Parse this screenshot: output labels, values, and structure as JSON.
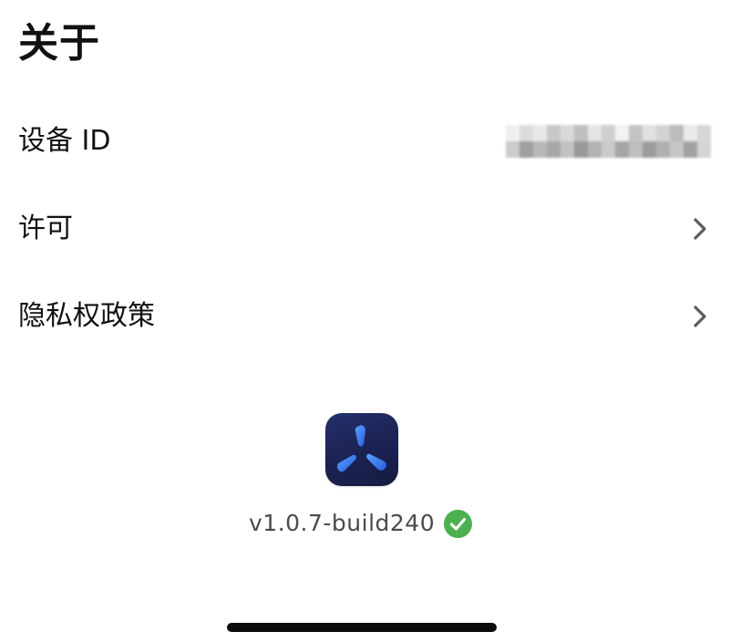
{
  "header": {
    "title": "关于"
  },
  "settings": {
    "device_id": {
      "label": "设备 ID",
      "value_pixelated": true
    },
    "license": {
      "label": "许可",
      "icon": "chevron-right-icon"
    },
    "privacy_policy": {
      "label": "隐私权政策",
      "icon": "chevron-right-icon"
    }
  },
  "app_info": {
    "icon": "app-logo-icon",
    "version": "v1.0.7-build240",
    "status_icon": "check-circle-icon",
    "status_color": "#4caf50"
  },
  "colors": {
    "text_primary": "#111111",
    "text_secondary": "#4a4a4a",
    "chevron": "#5a5d66",
    "icon_bg": "#1b2252",
    "icon_accent": "#3a7bff",
    "check_green": "#4caf50"
  }
}
